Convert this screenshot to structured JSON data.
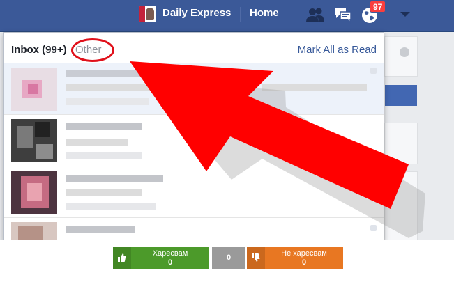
{
  "header": {
    "profile_name": "Daily Express",
    "home_label": "Home",
    "notification_count": "97",
    "icons": [
      "friends-icon",
      "messages-icon",
      "globe-icon",
      "caret-down-icon"
    ]
  },
  "dropdown": {
    "inbox_label": "Inbox (99+)",
    "other_label": "Other",
    "mark_all_label": "Mark All as Read"
  },
  "colors": {
    "facebook_blue": "#3b5998",
    "arrow_red": "#ff0000",
    "like_green": "#4c9a2a",
    "neutral_gray": "#9a9a9a",
    "dislike_orange": "#e87722"
  },
  "votes": {
    "like_label": "Харесвам",
    "like_count": "0",
    "neutral_count": "0",
    "dislike_label": "Не харесвам",
    "dislike_count": "0"
  }
}
